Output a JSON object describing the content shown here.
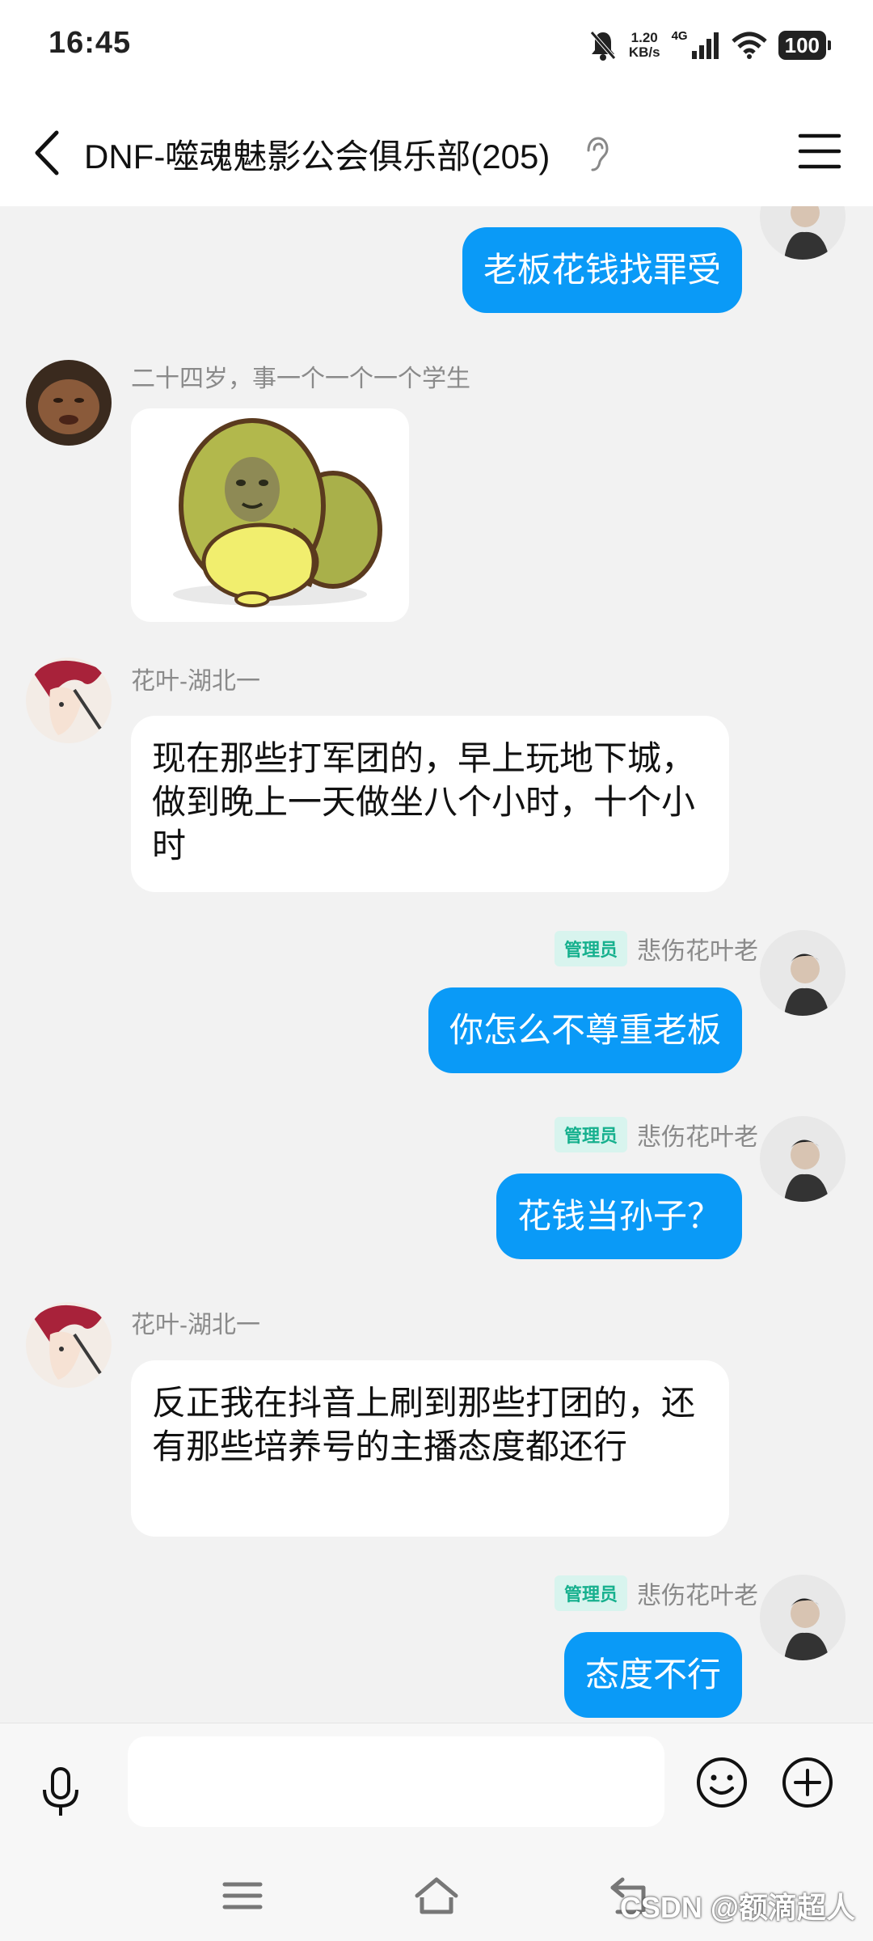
{
  "status_bar": {
    "time": "16:45",
    "net_speed_value": "1.20",
    "net_speed_unit": "KB/s",
    "signal_label": "4G",
    "battery": "100",
    "icons": [
      "bell-muted-icon",
      "signal-icon",
      "wifi-icon",
      "battery-icon"
    ]
  },
  "header": {
    "title": "DNF-噬魂魅影公会俱乐部(205)",
    "icons": [
      "back-arrow-icon",
      "ear-icon",
      "menu-icon"
    ]
  },
  "messages": [
    {
      "direction": "out",
      "sender": "",
      "admin_badge": "",
      "text": "老板花钱找罪受"
    },
    {
      "direction": "in",
      "sender": "二十四岁，事一个一个一个学生",
      "type": "sticker",
      "sticker": "green-duck-sticker"
    },
    {
      "direction": "in",
      "sender": "花叶-湖北一",
      "text": "现在那些打军团的，早上玩地下城，做到晚上一天做坐八个小时，十个小时"
    },
    {
      "direction": "out",
      "sender": "悲伤花叶老",
      "admin_badge": "管理员",
      "text": "你怎么不尊重老板"
    },
    {
      "direction": "out",
      "sender": "悲伤花叶老",
      "admin_badge": "管理员",
      "text": "花钱当孙子？"
    },
    {
      "direction": "in",
      "sender": "花叶-湖北一",
      "text": "反正我在抖音上刷到那些打团的，还有那些培养号的主播态度都还行"
    },
    {
      "direction": "out",
      "sender": "悲伤花叶老",
      "admin_badge": "管理员",
      "text": "态度不行"
    }
  ],
  "input_bar": {
    "placeholder": "",
    "icons": [
      "microphone-icon",
      "emoji-icon",
      "plus-icon"
    ]
  },
  "nav_bar": {
    "icons": [
      "recents-icon",
      "home-icon",
      "back-icon"
    ],
    "watermark": "CSDN @额滴超人"
  }
}
